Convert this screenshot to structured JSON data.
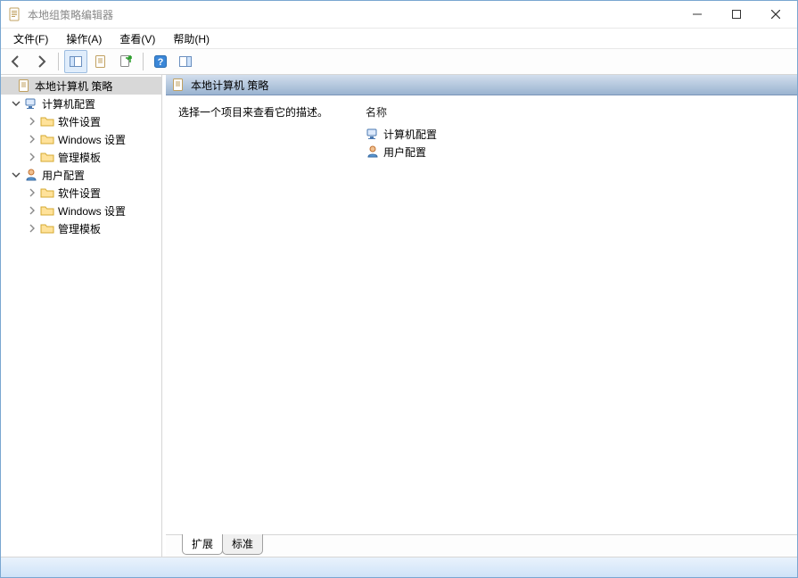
{
  "window": {
    "title": "本地组策略编辑器"
  },
  "menubar": {
    "file": "文件(F)",
    "action": "操作(A)",
    "view": "查看(V)",
    "help": "帮助(H)"
  },
  "toolbar": {
    "back": "back",
    "forward": "forward",
    "show_hide_tree": "show-hide-tree",
    "properties": "properties",
    "export": "export-list",
    "help": "help",
    "show_hide_action": "show-hide-action-pane"
  },
  "tree": {
    "root": "本地计算机 策略",
    "computer_config": "计算机配置",
    "cc_software": "软件设置",
    "cc_windows": "Windows 设置",
    "cc_templates": "管理模板",
    "user_config": "用户配置",
    "uc_software": "软件设置",
    "uc_windows": "Windows 设置",
    "uc_templates": "管理模板"
  },
  "detail": {
    "header_title": "本地计算机 策略",
    "description_prompt": "选择一个项目来查看它的描述。",
    "name_header": "名称",
    "items": {
      "computer_config": "计算机配置",
      "user_config": "用户配置"
    }
  },
  "tabs": {
    "extended": "扩展",
    "standard": "标准"
  }
}
